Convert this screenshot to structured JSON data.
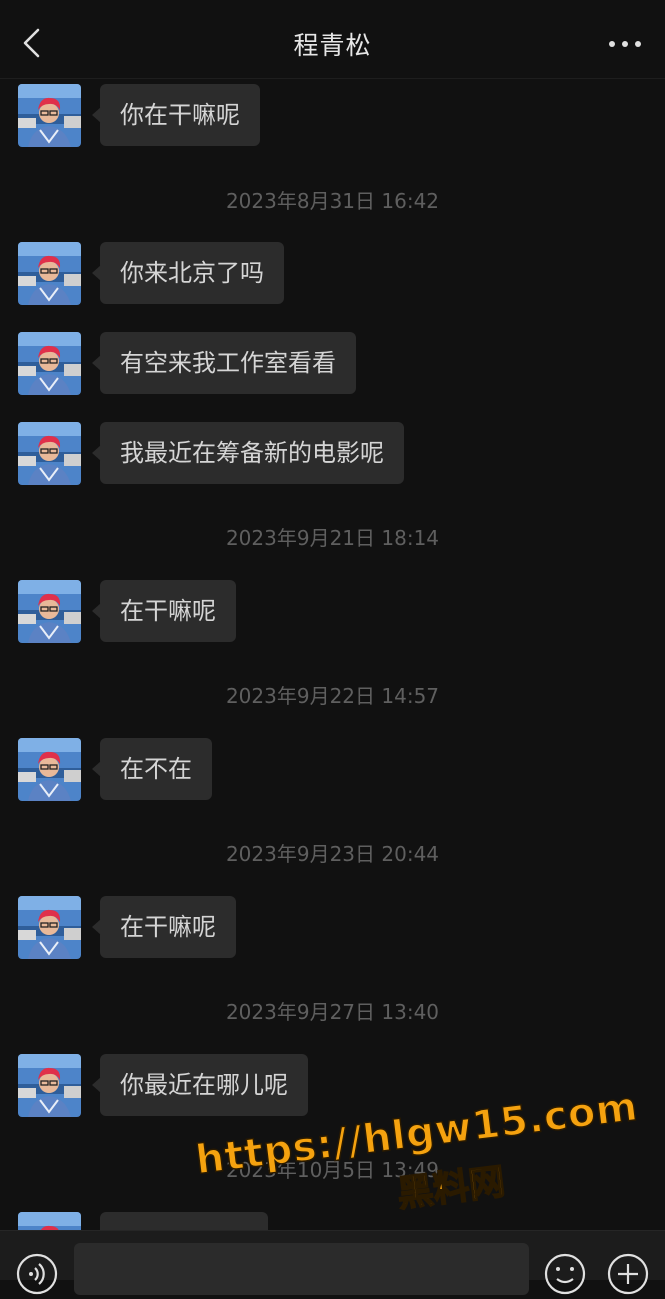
{
  "header": {
    "title": "程青松"
  },
  "messages": [
    {
      "type": "msg",
      "text": "你在干嘛呢"
    },
    {
      "type": "ts",
      "text": "2023年8月31日 16:42"
    },
    {
      "type": "msg",
      "text": "你来北京了吗"
    },
    {
      "type": "msg",
      "text": "有空来我工作室看看"
    },
    {
      "type": "msg",
      "text": "我最近在筹备新的电影呢"
    },
    {
      "type": "ts",
      "text": "2023年9月21日 18:14"
    },
    {
      "type": "msg",
      "text": "在干嘛呢"
    },
    {
      "type": "ts",
      "text": "2023年9月22日 14:57"
    },
    {
      "type": "msg",
      "text": "在不在"
    },
    {
      "type": "ts",
      "text": "2023年9月23日 20:44"
    },
    {
      "type": "msg",
      "text": "在干嘛呢"
    },
    {
      "type": "ts",
      "text": "2023年9月27日 13:40"
    },
    {
      "type": "msg",
      "text": "你最近在哪儿呢"
    },
    {
      "type": "ts",
      "text": "2023年10月5日 13:49"
    },
    {
      "type": "msg",
      "text": ""
    }
  ],
  "watermark": {
    "url": "https://hlgw15.com",
    "name": "黑料网"
  },
  "icons": {
    "back": "chevron-left-icon",
    "more": "more-dots-icon",
    "voice": "voice-icon",
    "emoji": "emoji-icon",
    "plus": "plus-icon"
  },
  "colors": {
    "background": "#111111",
    "bubble": "#2c2c2c",
    "bubble_text": "#d5d5d5",
    "timestamp": "#5f5f5f",
    "watermark": "#f5a20f"
  }
}
